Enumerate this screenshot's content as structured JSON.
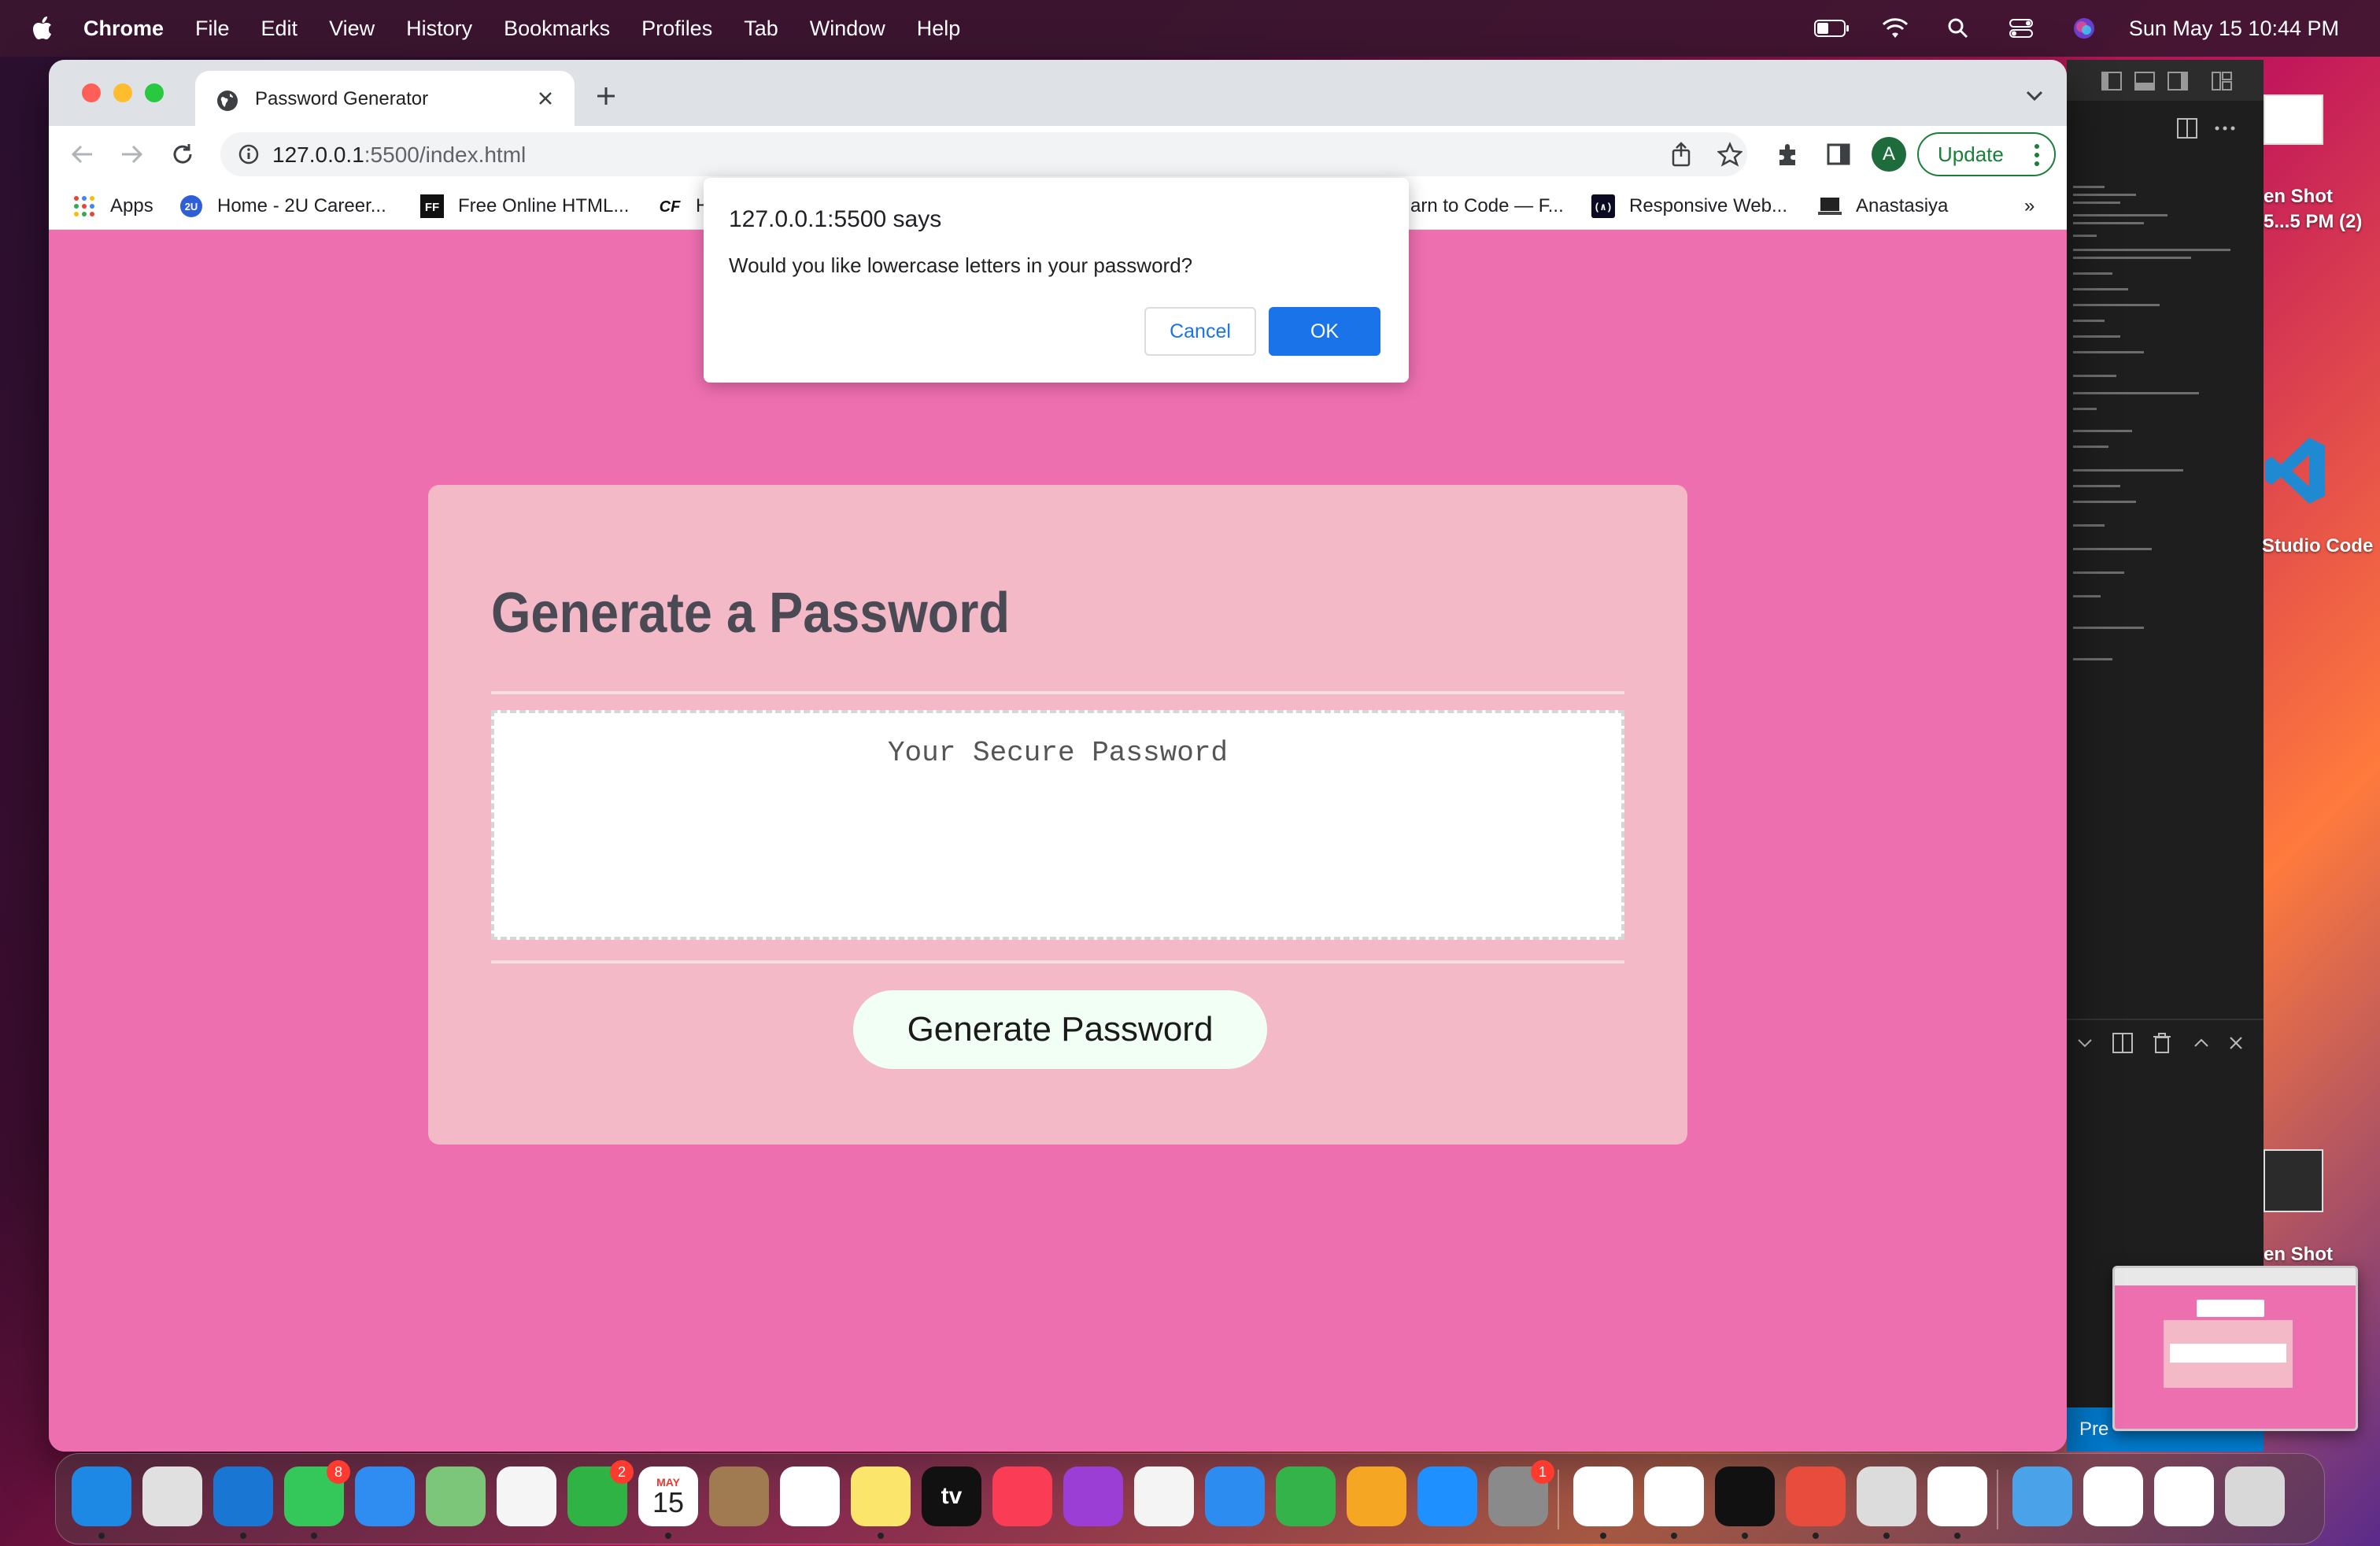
{
  "menubar": {
    "app_name": "Chrome",
    "items": [
      "File",
      "Edit",
      "View",
      "History",
      "Bookmarks",
      "Profiles",
      "Tab",
      "Window",
      "Help"
    ],
    "clock": "Sun May 15  10:44 PM"
  },
  "browser": {
    "tab_title": "Password Generator",
    "url_host": "127.0.0.1",
    "url_path": ":5500/index.html",
    "avatar_letter": "A",
    "update_label": "Update",
    "bookmarks": [
      {
        "label": "Apps"
      },
      {
        "label": "Home - 2U Career..."
      },
      {
        "label": "Free Online HTML..."
      },
      {
        "label": "H"
      },
      {
        "label": "arn to Code — F..."
      },
      {
        "label": "Responsive Web..."
      },
      {
        "label": "Anastasiya"
      }
    ],
    "bookmarks_overflow": "»"
  },
  "dialog": {
    "title": "127.0.0.1:5500 says",
    "message": "Would you like lowercase letters in your password?",
    "cancel_label": "Cancel",
    "ok_label": "OK"
  },
  "page": {
    "heading": "Generate a Password",
    "password_placeholder": "Your Secure Password",
    "generate_label": "Generate Password"
  },
  "desktop": {
    "screenshot_label_1a": "en Shot",
    "screenshot_label_1b": "5...5 PM (2)",
    "vscode_label": "Studio Code",
    "screenshot_label_2": "en Shot",
    "vscode_status_fragment": "Pre"
  },
  "dock": {
    "apps": [
      {
        "name": "Finder",
        "color": "#1e88e5"
      },
      {
        "name": "Launchpad",
        "color": "#e0e0e0"
      },
      {
        "name": "Safari",
        "color": "#1976d2"
      },
      {
        "name": "Messages",
        "color": "#34c759",
        "badge": "8"
      },
      {
        "name": "Mail",
        "color": "#2f8cf0"
      },
      {
        "name": "Maps",
        "color": "#7cc67a"
      },
      {
        "name": "Photos",
        "color": "#f5f5f5"
      },
      {
        "name": "FaceTime",
        "color": "#2fb344",
        "badge": "2"
      },
      {
        "name": "Calendar",
        "color": "#ffffff",
        "month": "MAY",
        "day": "15"
      },
      {
        "name": "Contacts",
        "color": "#a07a50"
      },
      {
        "name": "Reminders",
        "color": "#ffffff"
      },
      {
        "name": "Notes",
        "color": "#fbe66b"
      },
      {
        "name": "TV",
        "color": "#111111",
        "text": "tv"
      },
      {
        "name": "Music",
        "color": "#fa3c55"
      },
      {
        "name": "Podcasts",
        "color": "#9b3ed6"
      },
      {
        "name": "News",
        "color": "#f4f4f4"
      },
      {
        "name": "Keynote",
        "color": "#2d8cf0"
      },
      {
        "name": "Numbers",
        "color": "#34b34a"
      },
      {
        "name": "Pages",
        "color": "#f5a623"
      },
      {
        "name": "App Store",
        "color": "#1e90ff"
      },
      {
        "name": "System Preferences",
        "color": "#8a8a8a",
        "badge": "1"
      },
      {
        "name": "Slack",
        "color": "#ffffff"
      },
      {
        "name": "Visual Studio Code",
        "color": "#ffffff"
      },
      {
        "name": "Terminal",
        "color": "#111111"
      },
      {
        "name": "Airmail",
        "color": "#e74c3c"
      },
      {
        "name": "Preview",
        "color": "#dcdcdc"
      },
      {
        "name": "Google Chrome",
        "color": "#ffffff"
      },
      {
        "name": "Downloads",
        "color": "#4aa3e8"
      },
      {
        "name": "Recent Screenshot 1",
        "color": "#ffffff"
      },
      {
        "name": "Recent Screenshot 2",
        "color": "#ffffff"
      },
      {
        "name": "Trash",
        "color": "#d8d8d8"
      }
    ]
  }
}
